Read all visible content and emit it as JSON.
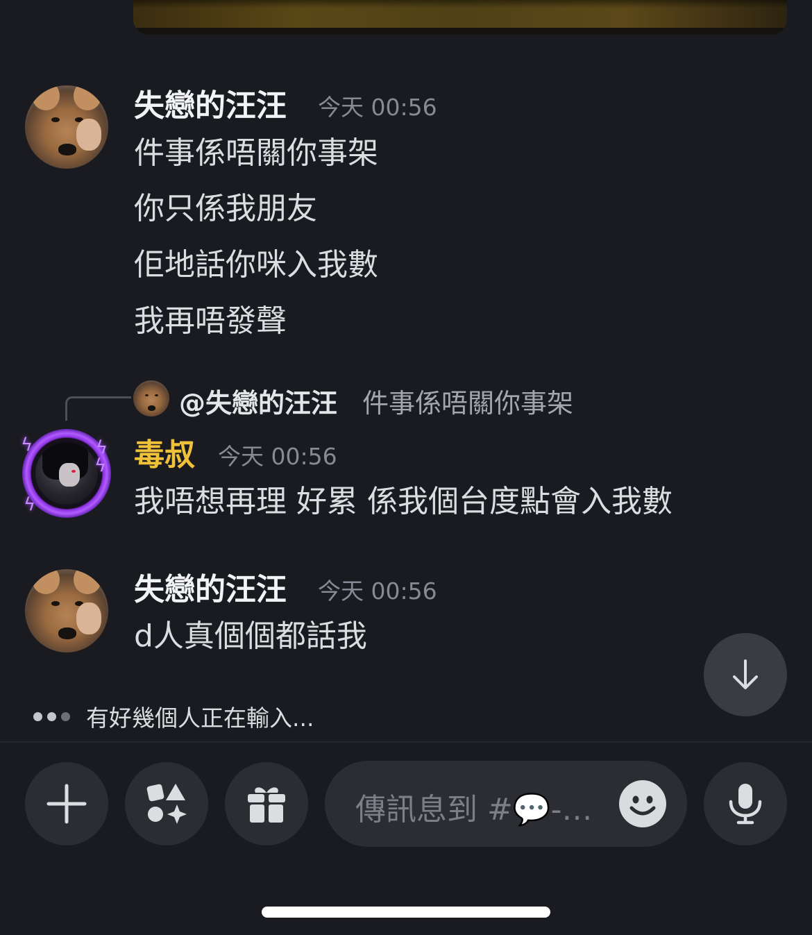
{
  "messages": [
    {
      "username": "失戀的汪汪",
      "timestamp": "今天 00:56",
      "lines": [
        "件事係唔關你事架",
        "你只係我朋友",
        "佢地話你咪入我數",
        "我再唔發聲"
      ]
    },
    {
      "reply": {
        "mention": "@失戀的汪汪",
        "text": "件事係唔關你事架"
      },
      "username": "毒叔",
      "username_color": "#f0c23a",
      "timestamp": "今天 00:56",
      "lines": [
        "我唔想再理 好累 係我個台度點會入我數"
      ]
    },
    {
      "username": "失戀的汪汪",
      "timestamp": "今天 00:56",
      "lines": [
        "d人真個個都話我"
      ]
    }
  ],
  "typing_indicator": "有好幾個人正在輸入...",
  "composer": {
    "placeholder": "傳訊息到 #💬-…"
  },
  "icons": {
    "scroll_down": "arrow-down-icon",
    "add": "plus-icon",
    "apps": "apps-icon",
    "gift": "gift-icon",
    "emoji": "emoji-icon",
    "mic": "microphone-icon"
  },
  "colors": {
    "background": "#1a1b20",
    "highlight_username": "#f0c23a",
    "avatar_ring": "#9b45ff"
  }
}
